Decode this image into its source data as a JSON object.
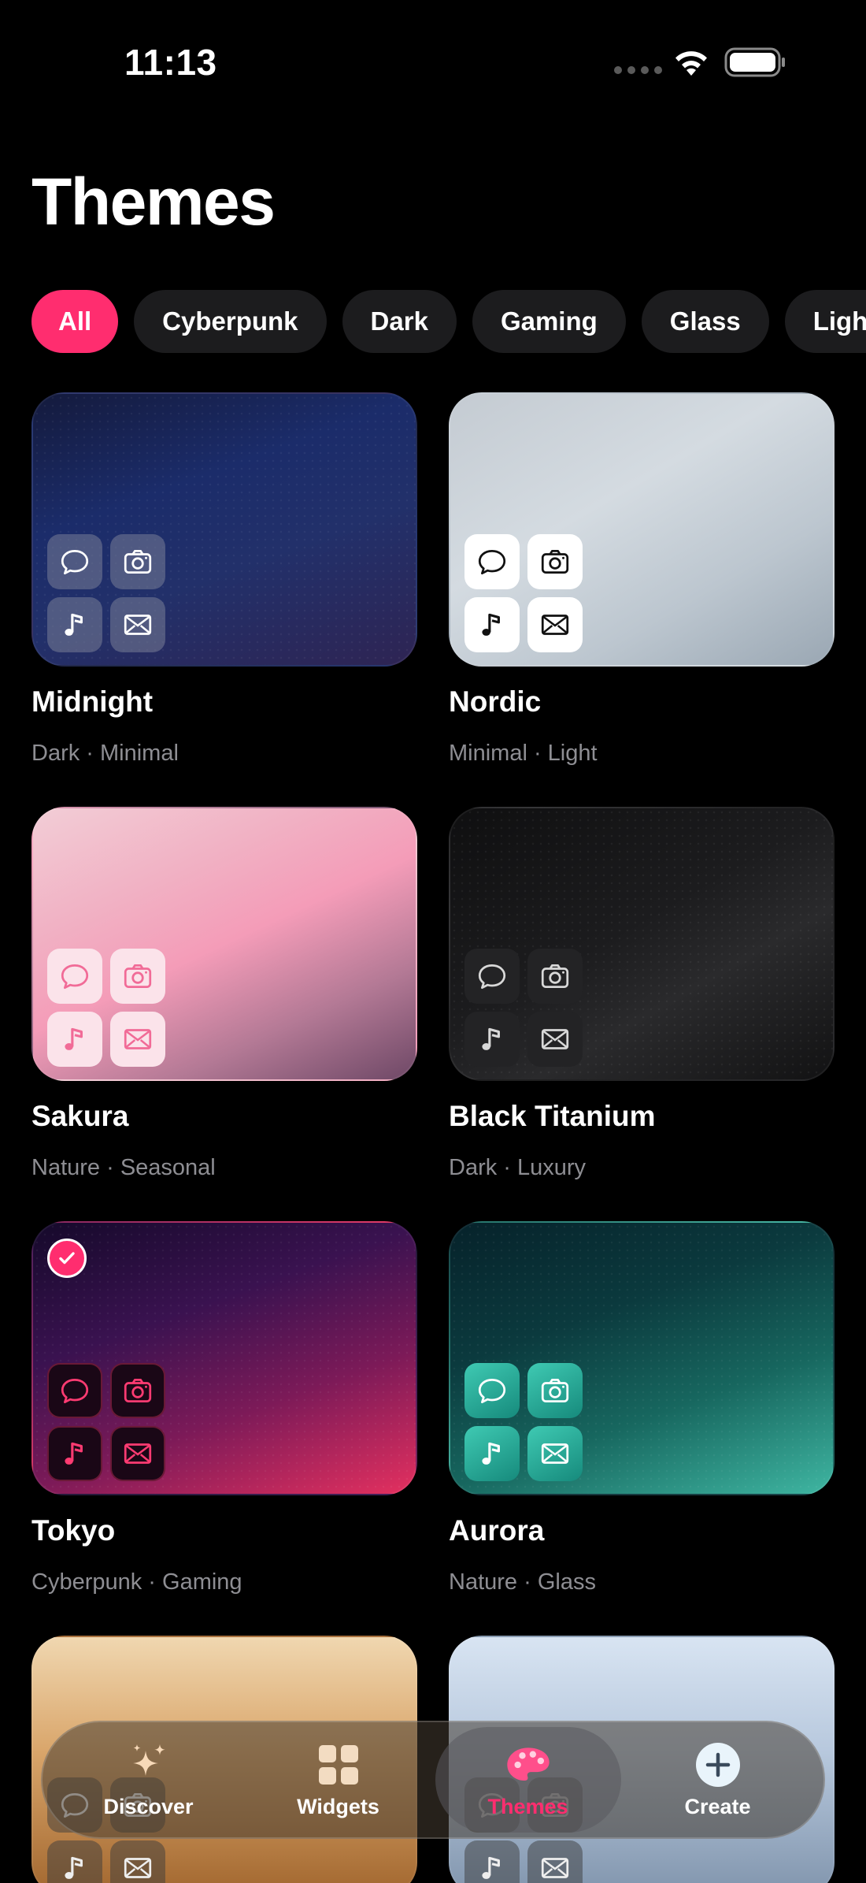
{
  "status_bar": {
    "time": "11:13"
  },
  "page_title": "Themes",
  "filters": {
    "chips": [
      "All",
      "Cyberpunk",
      "Dark",
      "Gaming",
      "Glass",
      "Light"
    ],
    "selected": "All"
  },
  "themes": [
    {
      "name": "Midnight",
      "tags": "Dark · Minimal",
      "selected": false
    },
    {
      "name": "Nordic",
      "tags": "Minimal · Light",
      "selected": false
    },
    {
      "name": "Sakura",
      "tags": "Nature · Seasonal",
      "selected": false
    },
    {
      "name": "Black Titanium",
      "tags": "Dark · Luxury",
      "selected": false
    },
    {
      "name": "Tokyo",
      "tags": "Cyberpunk · Gaming",
      "selected": true
    },
    {
      "name": "Aurora",
      "tags": "Nature · Glass",
      "selected": false
    }
  ],
  "theme_preview_icons": [
    "message-bubble-icon",
    "camera-icon",
    "music-note-icon",
    "mail-icon"
  ],
  "tab_bar": {
    "tabs": [
      {
        "label": "Discover",
        "icon": "sparkles-icon"
      },
      {
        "label": "Widgets",
        "icon": "widgets-grid-icon"
      },
      {
        "label": "Themes",
        "icon": "palette-icon"
      },
      {
        "label": "Create",
        "icon": "plus-circle-icon"
      }
    ],
    "active": "Themes"
  },
  "colors": {
    "accent": "#ff2d6f",
    "background": "#000000",
    "chip_bg": "#1c1c1e",
    "secondary_text": "#8e8e93"
  }
}
